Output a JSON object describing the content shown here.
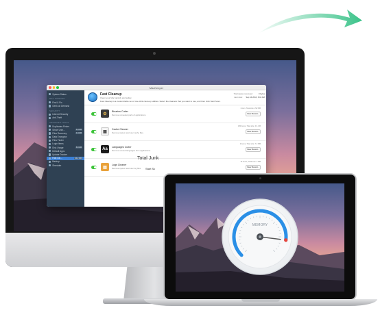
{
  "colors": {
    "arrow": "#3cc38a",
    "sidebar_bg": "#2f4153",
    "accent_blue": "#3b7fd4",
    "toggle_green": "#3ec43b",
    "gauge_blue": "#2a8fe6",
    "gauge_red": "#e8433a"
  },
  "app": {
    "window_title": "MacKeeper",
    "sidebar": {
      "items": [
        {
          "label": "System Status",
          "icon": "status-icon"
        },
        {
          "section": "MAC SUPPORT"
        },
        {
          "label": "Find & Fix",
          "icon": "tools-icon"
        },
        {
          "label": "Geek on Demand",
          "icon": "headset-icon"
        },
        {
          "section": "SECURITY"
        },
        {
          "label": "Internet Security",
          "icon": "shield-icon"
        },
        {
          "label": "Anti-Theft",
          "icon": "lock-icon"
        },
        {
          "section": "ADVANCED TOOLS"
        },
        {
          "label": "Duplicates Finder",
          "icon": "duplicates-icon"
        },
        {
          "label": "Smart Unin...",
          "icon": "uninstall-icon",
          "size": "0.4 GB"
        },
        {
          "label": "Files Recovery",
          "icon": "recovery-icon",
          "size": "1.4 GB"
        },
        {
          "label": "Data Encryptor",
          "icon": "encrypt-icon"
        },
        {
          "label": "Files Finder",
          "icon": "finder-icon"
        },
        {
          "label": "Login Items",
          "icon": "login-icon"
        },
        {
          "label": "Disk Usage",
          "icon": "disk-icon",
          "size": "6.9 GB"
        },
        {
          "label": "Default Apps",
          "icon": "apps-icon"
        },
        {
          "label": "Update Tracker",
          "icon": "update-icon"
        },
        {
          "label": "Fast Cle...",
          "icon": "broom-icon",
          "size": "94.2 MB",
          "active": true
        },
        {
          "label": "Backup",
          "icon": "backup-icon"
        },
        {
          "label": "Shredder",
          "icon": "shredder-icon"
        }
      ]
    },
    "header": {
      "title": "Fast Cleanup",
      "subtitle": "Clean your Mac quickly and safely.",
      "description": "Fast Cleanup is a customizable set of one-click clean-up utilities. Select the cleaners that you want to use, and then click Start Scan.",
      "storage_label": "Total space recovered",
      "storage_value": "0 bytes",
      "last_scan_label": "Last scan:",
      "last_scan_value": "Sep 16 2016, 6:10 AM"
    },
    "rows": [
      {
        "name": "Binaries Cutter",
        "desc": "Remove unneeded parts of applications.",
        "meta": "1 item, Total size: 292 MB",
        "button": "View Result...",
        "icon": "binaries-icon",
        "glyph": "⚙"
      },
      {
        "name": "Cache Cleaner",
        "desc": "Remove system and user cache files.",
        "meta": "183 items, Total size: 0.1 GB",
        "button": "View Result...",
        "icon": "cache-icon",
        "glyph": "▦"
      },
      {
        "name": "Languages Cutter",
        "desc": "Remove unused languages from applications.",
        "meta": "2 items, Total size: 7.2 MB",
        "button": "View Result...",
        "icon": "languages-icon",
        "glyph": "Aa"
      },
      {
        "name": "Logs Cleaner",
        "desc": "Remove system and user log files.",
        "meta": "16 items, Total size: 3 MB",
        "button": "View Result...",
        "icon": "logs-icon",
        "glyph": "▤"
      }
    ],
    "total_label": "Total Junk",
    "total_action": "Start Sc"
  },
  "gauge": {
    "label": "MEMORY",
    "level_fraction": 0.86
  }
}
